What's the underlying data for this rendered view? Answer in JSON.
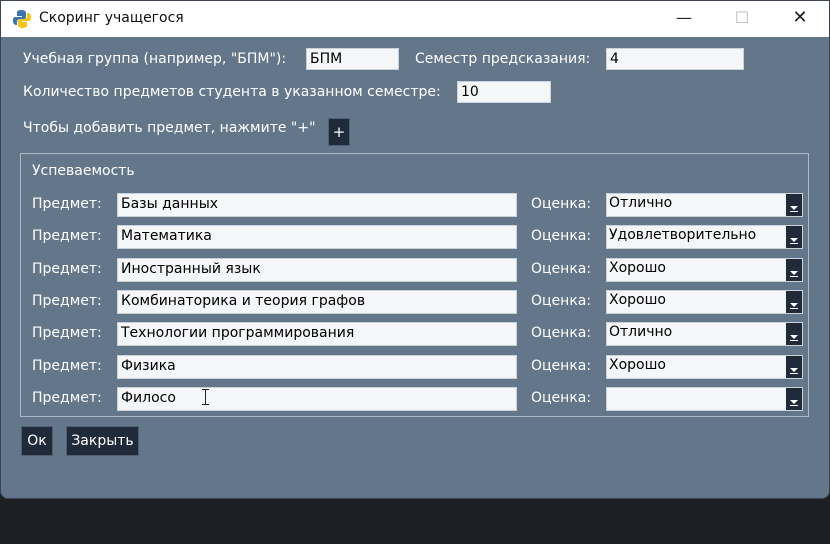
{
  "window": {
    "title": "Скоринг учащегося",
    "minimize_glyph": "—",
    "maximize_glyph": "☐",
    "close_glyph": "✕"
  },
  "form": {
    "group_label": "Учебная группа (например, \"БПМ\"):",
    "group_value": "БПМ",
    "semester_label": "Семестр предсказания:",
    "semester_value": "4",
    "count_label": "Количество предметов студента в указанном семестре:",
    "count_value": "10",
    "add_hint": "Чтобы добавить предмет, нажмите \"+\"",
    "add_button": "+"
  },
  "performance": {
    "title": "Успеваемость",
    "subject_label": "Предмет:",
    "grade_label": "Оценка:",
    "rows": [
      {
        "subject": "Базы данных",
        "grade": "Отлично"
      },
      {
        "subject": "Математика",
        "grade": "Удовлетворительно"
      },
      {
        "subject": "Иностранный язык",
        "grade": "Хорошо"
      },
      {
        "subject": "Комбинаторика и теория графов",
        "grade": "Хорошо"
      },
      {
        "subject": "Технологии программирования",
        "grade": "Отлично"
      },
      {
        "subject": "Физика",
        "grade": "Хорошо"
      },
      {
        "subject": "Филосо",
        "grade": ""
      }
    ]
  },
  "buttons": {
    "ok": "Ок",
    "close": "Закрыть"
  },
  "colors": {
    "window_bg": "#64778a",
    "button_bg": "#1f2b3a",
    "entry_bg": "#f4f6f8"
  }
}
